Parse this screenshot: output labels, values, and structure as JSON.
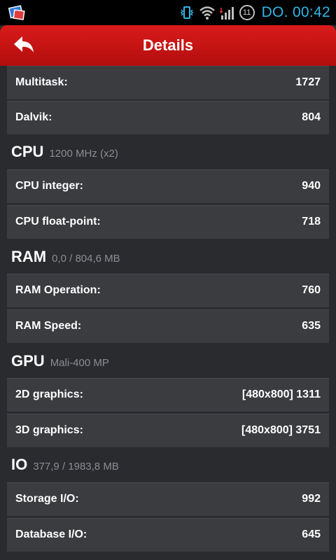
{
  "status_bar": {
    "clock": "DO. 00:42",
    "notification_count": "11",
    "icons": [
      "app-notification-icon",
      "vibrate-icon",
      "wifi-icon",
      "signal-icon"
    ]
  },
  "action_bar": {
    "title": "Details",
    "back_icon": "back-arrow-icon"
  },
  "colors": {
    "action_bar": "#c81414",
    "background": "#2a2b2f",
    "row": "#3b3c40",
    "clock": "#33b5e5",
    "subtitle": "#8c8d92"
  },
  "top_rows": [
    {
      "label": "Multitask:",
      "value": "1727"
    },
    {
      "label": "Dalvik:",
      "value": "804"
    }
  ],
  "sections": [
    {
      "title": "CPU",
      "subtitle": "1200 MHz (x2)",
      "rows": [
        {
          "label": "CPU integer:",
          "value": "940"
        },
        {
          "label": "CPU float-point:",
          "value": "718"
        }
      ]
    },
    {
      "title": "RAM",
      "subtitle": "0,0 / 804,6 MB",
      "rows": [
        {
          "label": "RAM Operation:",
          "value": "760"
        },
        {
          "label": "RAM Speed:",
          "value": "635"
        }
      ]
    },
    {
      "title": "GPU",
      "subtitle": "Mali-400 MP",
      "rows": [
        {
          "label": "2D graphics:",
          "value": "[480x800] 1311"
        },
        {
          "label": "3D graphics:",
          "value": "[480x800] 3751"
        }
      ]
    },
    {
      "title": "IO",
      "subtitle": "377,9 / 1983,8 MB",
      "rows": [
        {
          "label": "Storage I/O:",
          "value": "992"
        },
        {
          "label": "Database I/O:",
          "value": "645"
        }
      ]
    }
  ]
}
